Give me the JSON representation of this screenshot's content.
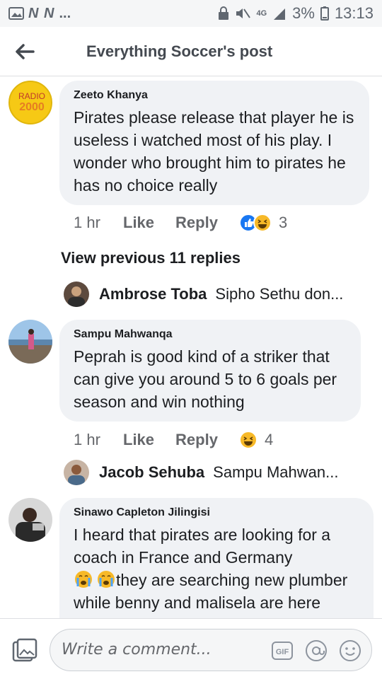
{
  "status": {
    "carrier_letters": "N N",
    "extra": "...",
    "network": "4G",
    "battery": "3%",
    "time": "13:13"
  },
  "header": {
    "title": "Everything Soccer's post"
  },
  "comments": [
    {
      "author": "Zeeto Khanya",
      "avatar_text": "RADIO 2000",
      "text": "Pirates please release that player he is useless i watched most of his play. I wonder who brought him to pirates he has no choice really",
      "time": "1 hr",
      "like": "Like",
      "reply": "Reply",
      "reaction_count": "3"
    },
    {
      "author": "Sampu Mahwanqa",
      "text": "Peprah is good kind of a striker that can give you around 5 to 6 goals per season and win nothing",
      "time": "1 hr",
      "like": "Like",
      "reply": "Reply",
      "reaction_count": "4"
    },
    {
      "author": "Sinawo Capleton Jilingisi",
      "text": "I heard that pirates are looking for a coach in France and Germany",
      "text2": "they are searching new plumber while benny and malisela are here"
    }
  ],
  "view_previous": "View previous 11 replies",
  "replies": [
    {
      "name": "Ambrose Toba",
      "text": "Sipho Sethu don..."
    },
    {
      "name": "Jacob Sehuba",
      "text": "Sampu Mahwan..."
    }
  ],
  "composer": {
    "placeholder": "Write a comment...",
    "gif": "GIF"
  },
  "colors": {
    "like_blue": "#1877f2",
    "haha_yellow": "#f7b928",
    "bubble": "#f0f2f5"
  }
}
